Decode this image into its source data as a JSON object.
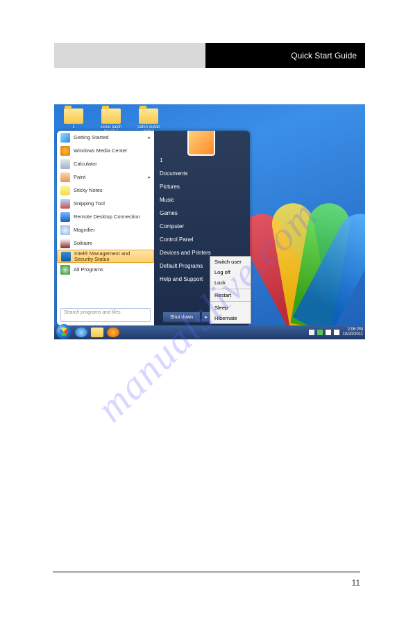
{
  "header": {
    "title": "Quick Start Guide"
  },
  "watermark": "manualslive.com",
  "desktop_icons": [
    {
      "label": "1"
    },
    {
      "label": "serial patch install 7"
    },
    {
      "label": "patch install mon2"
    }
  ],
  "startmenu": {
    "left": [
      {
        "label": "Getting Started",
        "icon": "i-gs",
        "submenu": true
      },
      {
        "label": "Windows Media Center",
        "icon": "i-wmp"
      },
      {
        "label": "Calculator",
        "icon": "i-calc"
      },
      {
        "label": "Paint",
        "icon": "i-paint",
        "submenu": true
      },
      {
        "label": "Sticky Notes",
        "icon": "i-sticky"
      },
      {
        "label": "Snipping Tool",
        "icon": "i-snip"
      },
      {
        "label": "Remote Desktop Connection",
        "icon": "i-rdp"
      },
      {
        "label": "Magnifier",
        "icon": "i-mag"
      },
      {
        "label": "Solitaire",
        "icon": "i-sol"
      },
      {
        "label": "Intel® Management and Security Status",
        "icon": "i-intel",
        "selected": true
      },
      {
        "label": "All Programs",
        "icon": "i-all",
        "all": true
      }
    ],
    "right": [
      "1",
      "Documents",
      "Pictures",
      "Music",
      "Games",
      "Computer",
      "Control Panel",
      "Devices and Printers",
      "Default Programs",
      "Help and Support"
    ],
    "search_placeholder": "Search programs and files",
    "shutdown_label": "Shut down"
  },
  "power_menu": [
    "Switch user",
    "Log off",
    "Lock",
    "-",
    "Restart",
    "-",
    "Sleep",
    "Hibernate"
  ],
  "tray": {
    "time": "2:06 PM",
    "date": "10/20/2011"
  },
  "page_number": "11"
}
